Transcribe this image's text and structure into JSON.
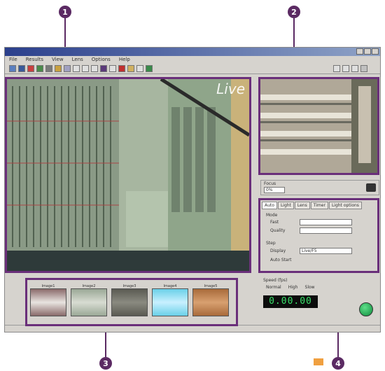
{
  "callouts": [
    "1",
    "2",
    "3",
    "4"
  ],
  "window": {
    "title": "",
    "menu": [
      "File",
      "Results",
      "View",
      "Lens",
      "Options",
      "Help"
    ],
    "live_label": "Live",
    "status_left": "",
    "status_mid": "",
    "status_right": ""
  },
  "control_panel": {
    "tabs": [
      "Auto",
      "Light",
      "Lens",
      "Timer",
      "Light options"
    ],
    "focus_label": "Focus",
    "focus_value": "0%",
    "mode_label": "Mode",
    "fast_label": "Fast",
    "quality_label": "Quality",
    "step_label": "Step",
    "step_value": "1 x",
    "display_label": "Display",
    "display_value": "Live/F5",
    "auto_start_label": "Auto Start",
    "speed_label": "Speed (fps)",
    "speed_options": [
      "Normal",
      "High",
      "Slow"
    ],
    "lcd_value": "0.00.00"
  },
  "gallery": {
    "thumbs": [
      {
        "label": "Image1",
        "color": "#8a6a6a"
      },
      {
        "label": "Image2",
        "color": "#9aa896"
      },
      {
        "label": "Image3",
        "color": "#5a5a52"
      },
      {
        "label": "Image4",
        "color": "#6ad0e8"
      },
      {
        "label": "Image5",
        "color": "#a86a3a"
      }
    ]
  },
  "colors": {
    "callout": "#5b2a63",
    "highlight": "#6a2f7a",
    "accent": "#f0a040"
  }
}
